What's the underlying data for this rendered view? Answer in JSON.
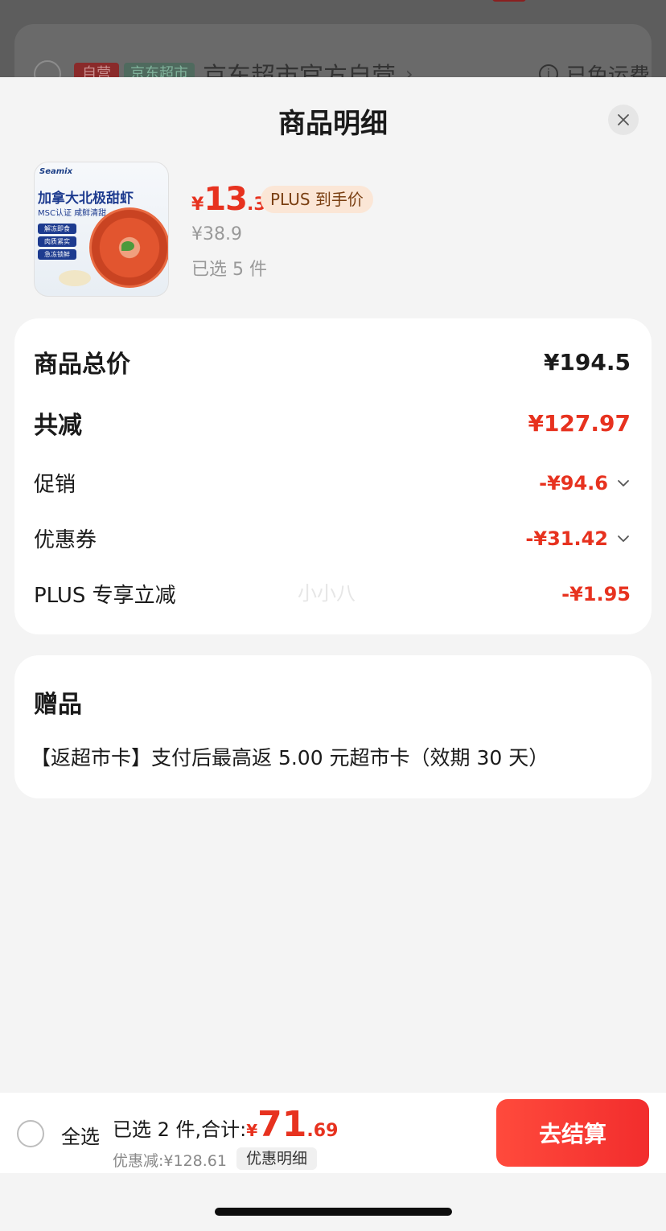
{
  "background_page": {
    "tag_self": "自营",
    "tag_market": "京东超市",
    "shop_name": "京东超市官方自营",
    "shipping": "已免运费"
  },
  "sheet": {
    "title": "商品明细"
  },
  "product": {
    "image_brand": "Seamix",
    "image_title": "加拿大北极甜虾",
    "image_subtitle": "MSC认证 咸鲜清甜",
    "image_badges": [
      "解冻即食",
      "肉质紧实",
      "急冻锁鲜"
    ],
    "price_yen": "¥",
    "price_int": "13",
    "price_dec": ".3",
    "plus_tag": "PLUS 到手价",
    "original_price": "¥38.9",
    "selected_count": "已选 5 件"
  },
  "summary": {
    "total_label": "商品总价",
    "total_value": "¥194.5",
    "reduce_label": "共减",
    "reduce_value": "¥127.97",
    "promo_label": "促销",
    "promo_value": "-¥94.6",
    "coupon_label": "优惠券",
    "coupon_value": "-¥31.42",
    "plus_label": "PLUS 专享立减",
    "plus_value": "-¥1.95",
    "watermark": "小小八"
  },
  "gifts": {
    "title": "赠品",
    "item": "【返超市卡】支付后最高返 5.00 元超市卡（效期 30 天）"
  },
  "bottom_bar": {
    "select_all": "全选",
    "total_prefix": "已选 2 件,合计:",
    "total_yen": "¥",
    "total_int": "71",
    "total_dec": ".69",
    "discount": "优惠减:¥128.61",
    "detail_chip": "优惠明细",
    "checkout": "去结算"
  },
  "colors": {
    "accent_red": "#e7321f",
    "button_red": "#f22d2d",
    "plus_tag_bg": "#fbe6d6",
    "background": "#f4f4f4"
  }
}
